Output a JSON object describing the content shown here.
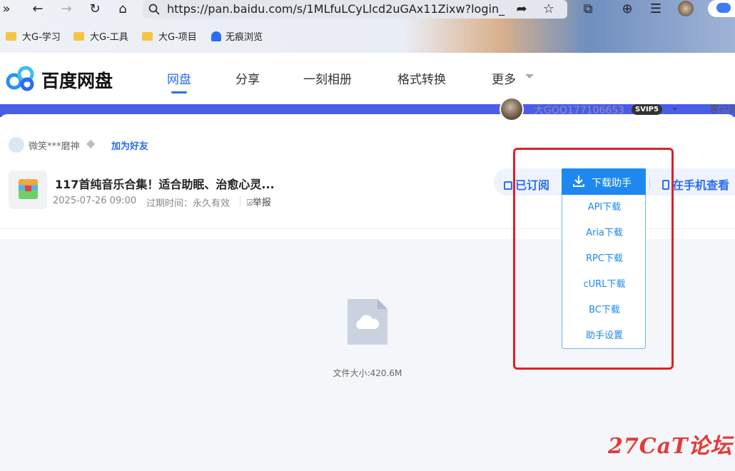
{
  "browser": {
    "url": "https://pan.baidu.com/s/1MLfuLCyLlcd2uGAx11Zixw?login_",
    "bookmarks": [
      "大G-学习",
      "大G-工具",
      "大G-项目",
      "无痕浏览"
    ]
  },
  "header": {
    "logo_text": "百度网盘",
    "nav": [
      "网盘",
      "分享",
      "一刻相册",
      "格式转换",
      "更多"
    ],
    "active_nav": "网盘"
  },
  "user": {
    "name": "大GQQ177106653",
    "vip": "SVIP5",
    "client_link": "客户端"
  },
  "share": {
    "sharer": "微笑***磨神",
    "add_friend": "加为好友",
    "title": "117首纯音乐合集！适合助眠、治愈心灵...",
    "date": "2025-07-26 09:00",
    "expire": "过期时间：永久有效",
    "report": "举报"
  },
  "actions": {
    "subscribed": "已订阅",
    "download_helper": "下载助手",
    "view_on_phone": "在手机查看"
  },
  "dropdown": [
    "API下载",
    "Aria下载",
    "RPC下载",
    "cURL下载",
    "BC下载",
    "助手设置"
  ],
  "file": {
    "size": "文件大小:420.6M"
  },
  "watermark": "27CaT论坛",
  "colors": {
    "accent": "#2a6df4",
    "download_button": "#1e88f0",
    "band": "#4b5de7",
    "highlight_box": "#e0202b"
  }
}
